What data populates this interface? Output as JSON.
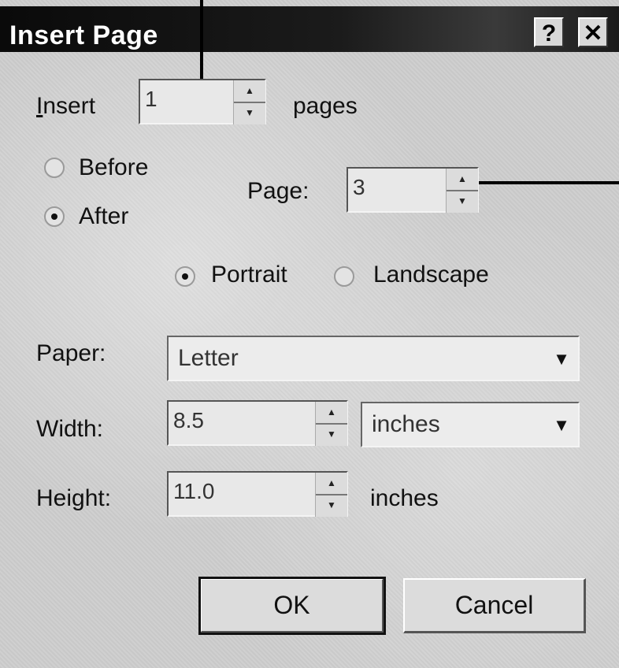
{
  "title": "Insert Page",
  "titlebar_buttons": {
    "help": "?",
    "close": "✕"
  },
  "insert": {
    "label": "Insert",
    "value": "1",
    "suffix": "pages"
  },
  "position": {
    "before": "Before",
    "after": "After",
    "selected": "after"
  },
  "page": {
    "label": "Page:",
    "value": "3"
  },
  "orientation": {
    "portrait": "Portrait",
    "landscape": "Landscape",
    "selected": "portrait"
  },
  "paper": {
    "label": "Paper:",
    "value": "Letter"
  },
  "width": {
    "label": "Width:",
    "value": "8.5",
    "unit": "inches"
  },
  "height": {
    "label": "Height:",
    "value": "11.0",
    "unit": "inches"
  },
  "buttons": {
    "ok": "OK",
    "cancel": "Cancel"
  },
  "icons": {
    "spin_up": "▲",
    "spin_down": "▼",
    "dropdown": "▼"
  }
}
